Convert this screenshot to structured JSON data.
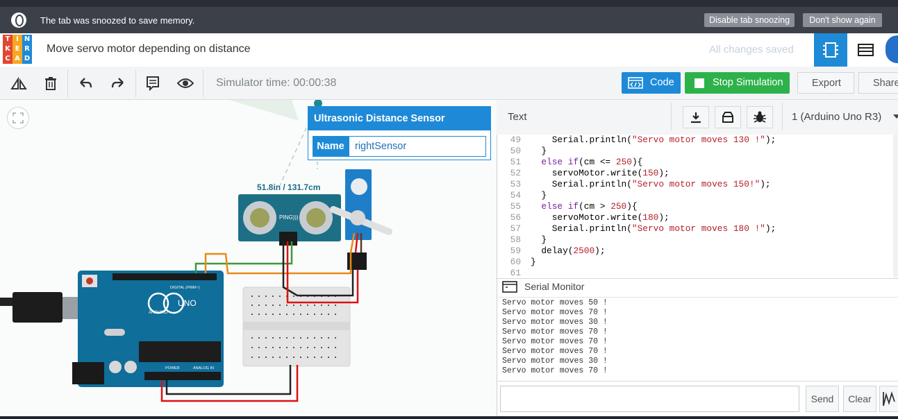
{
  "browser_bar": {
    "message": "The tab was snoozed to save memory.",
    "disable_btn": "Disable tab snoozing",
    "dont_show_btn": "Don't show again"
  },
  "logo": {
    "letters": [
      "T",
      "I",
      "N",
      "K",
      "E",
      "R",
      "C",
      "A",
      "D"
    ],
    "colors": [
      "#e2472f",
      "#f7a723",
      "#1f8ad7",
      "#e2472f",
      "#f7a723",
      "#1f8ad7",
      "#e2472f",
      "#f7a723",
      "#1f8ad7"
    ]
  },
  "header": {
    "project_title": "Move servo motor depending on distance",
    "save_status": "All changes saved"
  },
  "toolbar": {
    "simulator_time": "Simulator time: 00:00:38",
    "code_label": "Code",
    "stop_label": "Stop Simulation",
    "export_label": "Export",
    "share_label": "Share"
  },
  "inspector": {
    "title": "Ultrasonic Distance Sensor",
    "name_label": "Name",
    "name_value": "rightSensor"
  },
  "canvas": {
    "distance_readout": "51.8in / 131.7cm",
    "sensor_label": "PING)))",
    "arduino_brand": "ARDUINO",
    "arduino_model": "UNO",
    "digital_label": "DIGITAL (PWM~)",
    "power_label": "POWER",
    "analog_label": "ANALOG IN"
  },
  "code_panel": {
    "mode": "Text",
    "board": "1 (Arduino Uno R3)",
    "lines": [
      {
        "n": "49",
        "t": "    Serial.println(\"Servo motor moves 130 !\");"
      },
      {
        "n": "50",
        "t": "  }"
      },
      {
        "n": "51",
        "t": "  else if(cm <= 250){"
      },
      {
        "n": "52",
        "t": "    servoMotor.write(150);"
      },
      {
        "n": "53",
        "t": "    Serial.println(\"Servo motor moves 150!\");"
      },
      {
        "n": "54",
        "t": "  }"
      },
      {
        "n": "55",
        "t": "  else if(cm > 250){"
      },
      {
        "n": "56",
        "t": "    servoMotor.write(180);"
      },
      {
        "n": "57",
        "t": "    Serial.println(\"Servo motor moves 180 !\");"
      },
      {
        "n": "58",
        "t": "  }"
      },
      {
        "n": "59",
        "t": "  delay(2500);"
      },
      {
        "n": "60",
        "t": "}"
      },
      {
        "n": "61",
        "t": ""
      }
    ]
  },
  "serial_monitor": {
    "title": "Serial Monitor",
    "output": [
      "Servo motor moves 50 !",
      "Servo motor moves 70 !",
      "Servo motor moves 30 !",
      "Servo motor moves 70 !",
      "Servo motor moves 70 !",
      "Servo motor moves 70 !",
      "Servo motor moves 30 !",
      "Servo motor moves 70 !"
    ],
    "send_label": "Send",
    "clear_label": "Clear"
  },
  "icons": {
    "accent": "#1e8ad7",
    "go": "#2db24a"
  }
}
